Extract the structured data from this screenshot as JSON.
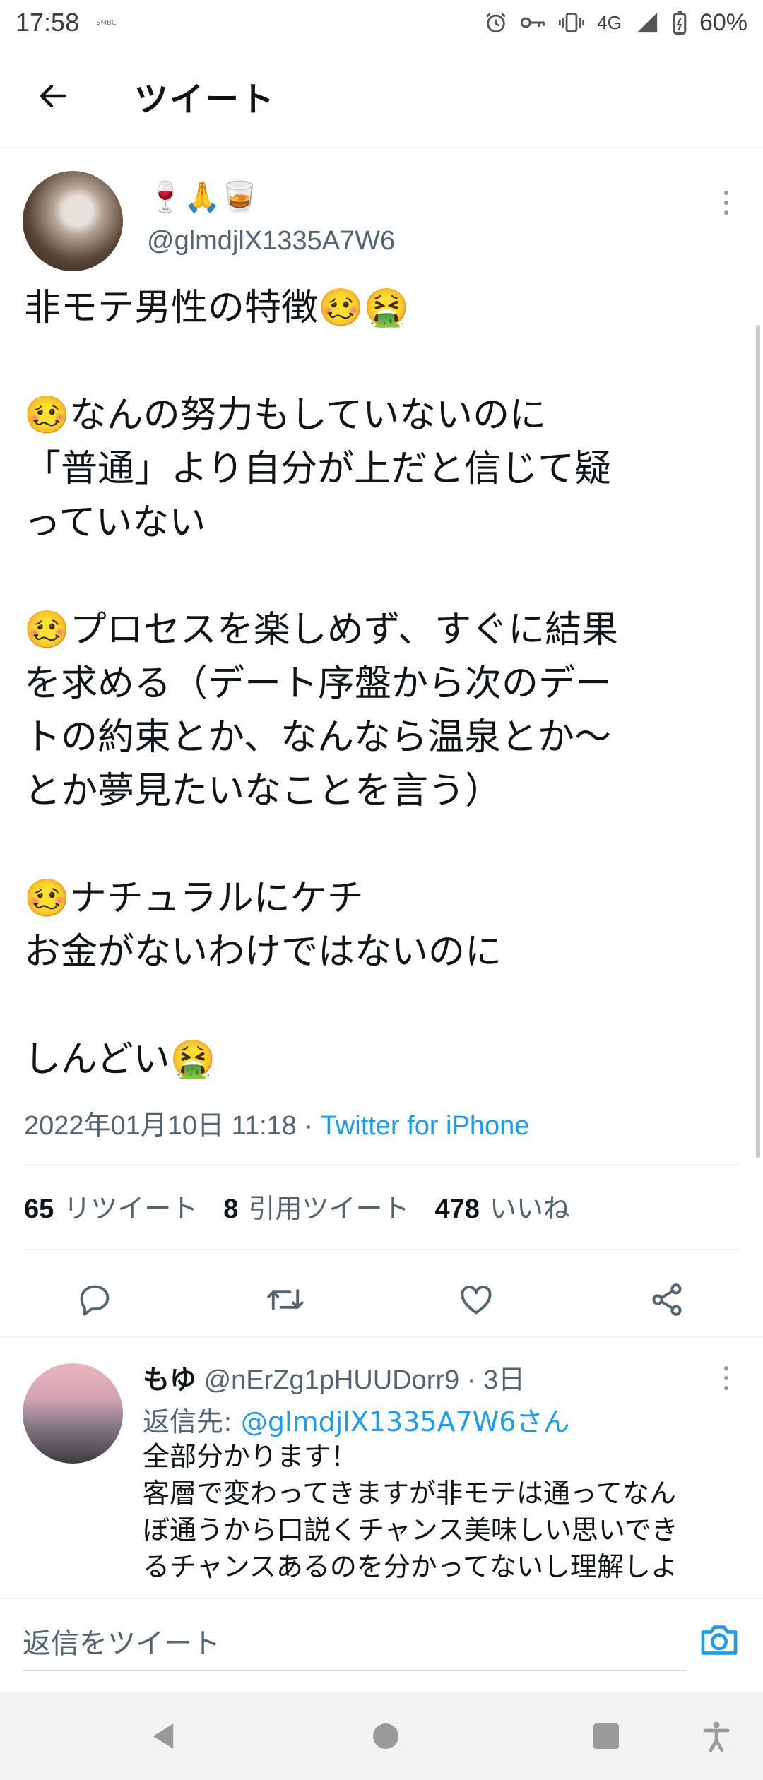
{
  "status_bar": {
    "time": "17:58",
    "carrier_small": "SMBC",
    "network": "4G",
    "battery": "60%"
  },
  "header": {
    "title": "ツイート",
    "back_icon": "arrow-left-icon"
  },
  "tweet": {
    "author_emojis": "🍷🙏🥃",
    "handle": "@glmdjlX1335A7W6",
    "text": "非モテ男性の特徴🥴🤮\n\n🥴なんの努力もしていないのに\n「普通」より自分が上だと信じて疑\nっていない\n\n🥴プロセスを楽しめず、すぐに結果\nを求める（デート序盤から次のデー\nトの約束とか、なんなら温泉とか〜\nとか夢見たいなことを言う）\n\n🥴ナチュラルにケチ\nお金がないわけではないのに\n\nしんどい🤮",
    "timestamp": "2022年01月10日 11:18",
    "separator": " · ",
    "source": "Twitter for iPhone",
    "stats": {
      "retweets_count": "65",
      "retweets_label": "リツイート",
      "quotes_count": "8",
      "quotes_label": "引用ツイート",
      "likes_count": "478",
      "likes_label": "いいね"
    }
  },
  "reply": {
    "name": "もゆ",
    "handle": "@nErZg1pHUUDorr9",
    "dot": " · ",
    "age": "3日",
    "reply_to_label": "返信先: ",
    "reply_to_mention": "@glmdjlX1335A7W6さん",
    "text": "全部分かります！\n客層で変わってきますが非モテは通ってなん\nぼ通うから口説くチャンス美味しい思いでき\nるチャンスあるのを分かってないし理解しよ"
  },
  "compose": {
    "placeholder": "返信をツイート"
  },
  "colors": {
    "accent": "#1d9bf0",
    "secondary_text": "#536471",
    "primary_text": "#0f1419",
    "divider": "#eff3f4"
  }
}
